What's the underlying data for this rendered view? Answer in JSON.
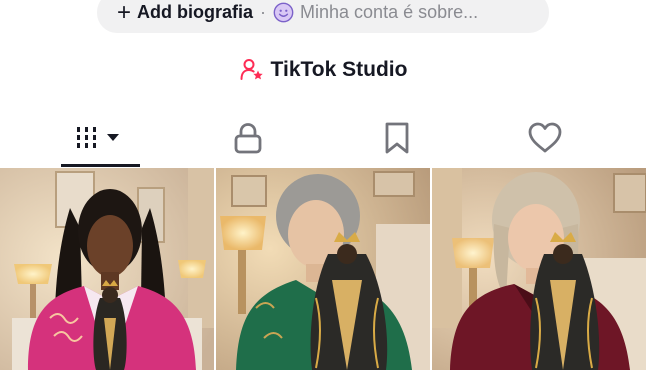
{
  "bio": {
    "add_icon": "plus-icon",
    "add_label": "Add biografia",
    "separator": "·",
    "prompt_icon": "smile-icon",
    "prompt_text": "Minha conta é sobre..."
  },
  "studio": {
    "icon": "person-star-icon",
    "label": "TikTok Studio",
    "icon_color": "#fe2c55"
  },
  "tabs": [
    {
      "name": "videos",
      "icon": "grid-dropdown-icon",
      "selected": true
    },
    {
      "name": "private",
      "icon": "lock-icon",
      "selected": false
    },
    {
      "name": "favorites",
      "icon": "bookmark-icon",
      "selected": false
    },
    {
      "name": "liked",
      "icon": "heart-icon",
      "selected": false
    }
  ],
  "videos": [
    {
      "thumbnail": "woman-pink-jacket-with-statue"
    },
    {
      "thumbnail": "older-woman-green-blouse-with-statue"
    },
    {
      "thumbnail": "older-woman-burgundy-velvet-with-statue"
    }
  ]
}
